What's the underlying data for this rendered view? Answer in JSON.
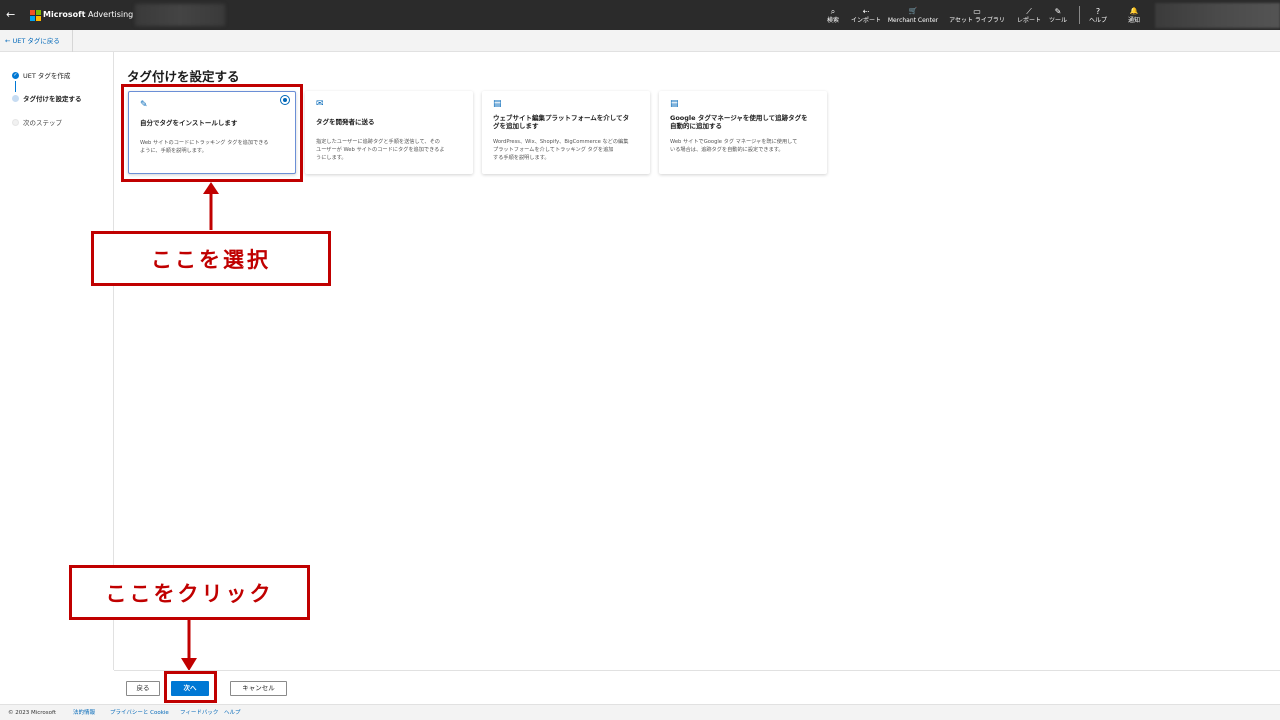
{
  "topbar": {
    "brand_name": "Microsoft",
    "brand_product": "Advertising",
    "nav": [
      {
        "icon": "search-icon",
        "glyph": "⌕",
        "label": "検索"
      },
      {
        "icon": "import-icon",
        "glyph": "⇠",
        "label": "インポート"
      },
      {
        "icon": "cart-icon",
        "glyph": "🛒",
        "label": "Merchant Center"
      },
      {
        "icon": "asset-library-icon",
        "glyph": "▭",
        "label": "アセット ライブラリ"
      },
      {
        "icon": "report-icon",
        "glyph": "⟋",
        "label": "レポート"
      },
      {
        "icon": "tools-icon",
        "glyph": "✎",
        "label": "ツール"
      },
      {
        "icon": "help-icon",
        "glyph": "?",
        "label": "ヘルプ"
      },
      {
        "icon": "bell-icon",
        "glyph": "🔔",
        "label": "通知"
      }
    ]
  },
  "subbar": {
    "back_link": "← UET タグに戻る"
  },
  "stepper": {
    "steps": [
      {
        "label": "UET タグを作成",
        "state": "done"
      },
      {
        "label": "タグ付けを設定する",
        "state": "current"
      },
      {
        "label": "次のステップ",
        "state": "pending"
      }
    ]
  },
  "main": {
    "title": "タグ付けを設定する",
    "cards": [
      {
        "icon": "pencil-icon",
        "glyph": "✎",
        "title": "自分でタグをインストールします",
        "desc": "Web サイトのコードにトラッキング タグを追加できる\nように、手順を説明します。",
        "selected": true
      },
      {
        "icon": "mail-icon",
        "glyph": "✉",
        "title": "タグを開発者に送る",
        "desc": "指定したユーザーに追跡タグと手順を送信して、その\nユーザーが Web サイトのコードにタグを追加できるよ\nうにします。",
        "selected": false
      },
      {
        "icon": "website-platform-icon",
        "glyph": "▤",
        "title": "ウェブサイト編集プラットフォームを介してタ\nグを追加します",
        "desc": "WordPress、Wix、Shopify、BigCommerce などの編集\nプラットフォームを介してトラッキング タグを追加\nする手順を説明します。",
        "selected": false
      },
      {
        "icon": "tag-manager-icon",
        "glyph": "▤",
        "title": "Google タグマネージャを使用して追跡タグを\n自動的に追加する",
        "desc": "Web サイトでGoogle タグ マネージャを既に使用して\nいる場合は、追跡タグを自動的に設定できます。",
        "selected": false
      }
    ]
  },
  "annotations": {
    "select_label": "ここを選択",
    "click_label": "ここをクリック",
    "color": "#c00000"
  },
  "actions": {
    "back": "戻る",
    "next": "次へ",
    "cancel": "キャンセル"
  },
  "footer": {
    "copyright": "© 2023 Microsoft",
    "links": [
      "法的情報",
      "プライバシーと Cookie",
      "フィードバック",
      "ヘルプ"
    ]
  },
  "colors": {
    "topbar": "#2b2b2b",
    "accent": "#0078d4",
    "link": "#0067b8"
  }
}
